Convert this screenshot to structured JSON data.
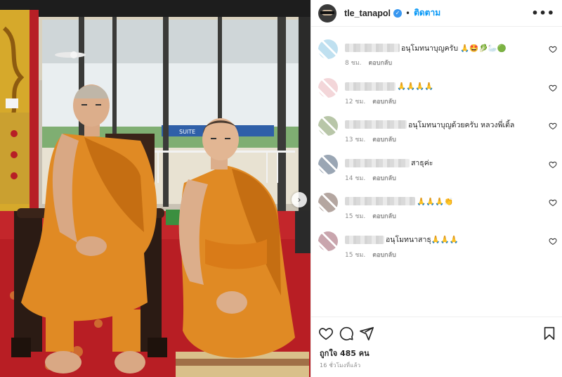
{
  "post": {
    "username": "tle_tanapol",
    "follow_label": "ติดตาม",
    "separator": "•",
    "verified_mark": "✓",
    "more_icon": "more-horizontal-icon"
  },
  "photo": {
    "next_arrow": "›",
    "background_sign_text": "SUITE"
  },
  "comments": [
    {
      "text": "อนุโมทนาบุญครับ 🙏🤩🥬🦢🟢",
      "time": "8 ชม.",
      "reply": "ตอบกลับ",
      "avatar_color": "#bfe0f0",
      "name_width": 78
    },
    {
      "text": "🙏🙏🙏🙏",
      "time": "12 ชม.",
      "reply": "ตอบกลับ",
      "avatar_color": "#f3d6d9",
      "name_width": 72
    },
    {
      "text": "อนุโมทนาบุญด้วยครับ หลวงพี่เติ้ล",
      "time": "13 ชม.",
      "reply": "ตอบกลับ",
      "avatar_color": "#b8c6a8",
      "name_width": 88
    },
    {
      "text": "สาธุค่ะ",
      "time": "14 ชม.",
      "reply": "ตอบกลับ",
      "avatar_color": "#9aa6b4",
      "name_width": 92
    },
    {
      "text": "🙏🙏🙏👏",
      "time": "15 ชม.",
      "reply": "ตอบกลับ",
      "avatar_color": "#b4a6a0",
      "name_width": 100
    },
    {
      "text": "อนุโมทนาสาธุ🙏🙏🙏",
      "time": "15 ชม.",
      "reply": "ตอบกลับ",
      "avatar_color": "#c9a5ad",
      "name_width": 56
    }
  ],
  "actions": {
    "icons": [
      "heart-icon",
      "comment-icon",
      "share-icon",
      "bookmark-icon"
    ],
    "likes_label": "ถูกใจ 485 คน",
    "time_ago": "16 ชั่วโมงที่แล้ว"
  },
  "colors": {
    "robe": "#e08a24",
    "robe_shadow": "#c56e12",
    "carpet": "#b81e24",
    "link_blue": "#0095f6",
    "verified_blue": "#3897f0"
  }
}
